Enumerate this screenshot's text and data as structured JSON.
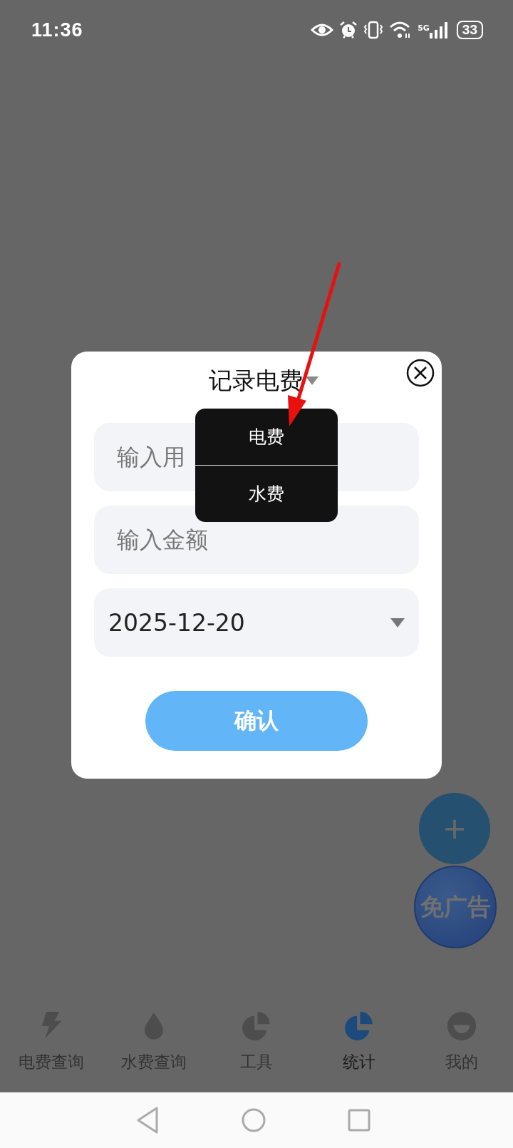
{
  "status_bar": {
    "time": "11:36",
    "network": "5G",
    "battery": "33"
  },
  "dialog": {
    "title": "记录电费",
    "fields": [
      {
        "kind": "text",
        "placeholder": "输入用"
      },
      {
        "kind": "text",
        "placeholder": "输入金额"
      },
      {
        "kind": "date",
        "value": "2025-12-20"
      }
    ],
    "confirm_button": "确认"
  },
  "dropdown_menu": {
    "items": [
      {
        "label": "电费"
      },
      {
        "label": "水费"
      }
    ]
  },
  "floating_buttons": {
    "add": "+",
    "ad_free": "免广告"
  },
  "bottom_nav": {
    "tabs": [
      {
        "label": "电费查询",
        "kind": "bolt",
        "selected": false
      },
      {
        "label": "水费查询",
        "kind": "drop",
        "selected": false
      },
      {
        "label": "工具",
        "kind": "pie",
        "selected": false
      },
      {
        "label": "统计",
        "kind": "pie",
        "selected": true
      },
      {
        "label": "我的",
        "kind": "face",
        "selected": false
      }
    ]
  }
}
